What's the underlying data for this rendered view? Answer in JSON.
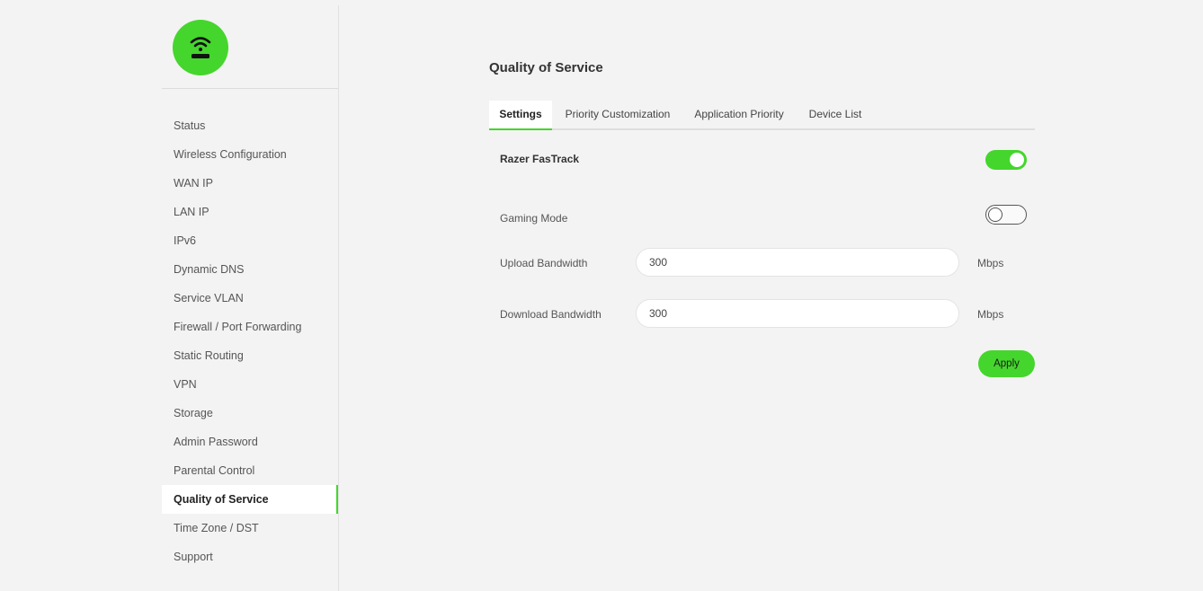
{
  "sidebar": {
    "logo_icon": "wifi-router-icon",
    "items": [
      {
        "label": "Status"
      },
      {
        "label": "Wireless Configuration"
      },
      {
        "label": "WAN IP"
      },
      {
        "label": "LAN IP"
      },
      {
        "label": "IPv6"
      },
      {
        "label": "Dynamic DNS"
      },
      {
        "label": "Service VLAN"
      },
      {
        "label": "Firewall / Port Forwarding"
      },
      {
        "label": "Static Routing"
      },
      {
        "label": "VPN"
      },
      {
        "label": "Storage"
      },
      {
        "label": "Admin Password"
      },
      {
        "label": "Parental Control"
      },
      {
        "label": "Quality of Service",
        "active": true
      },
      {
        "label": "Time Zone / DST"
      },
      {
        "label": "Support"
      }
    ]
  },
  "main": {
    "title": "Quality of Service",
    "tabs": [
      {
        "label": "Settings",
        "active": true
      },
      {
        "label": "Priority Customization"
      },
      {
        "label": "Application Priority"
      },
      {
        "label": "Device List"
      }
    ],
    "fastrack": {
      "label": "Razer FasTrack",
      "enabled": true
    },
    "gaming_mode": {
      "label": "Gaming Mode",
      "enabled": false
    },
    "upload": {
      "label": "Upload Bandwidth",
      "value": "300",
      "unit": "Mbps"
    },
    "download": {
      "label": "Download Bandwidth",
      "value": "300",
      "unit": "Mbps"
    },
    "apply_label": "Apply"
  },
  "colors": {
    "accent": "#44d62c",
    "background": "#f3f3f3"
  }
}
